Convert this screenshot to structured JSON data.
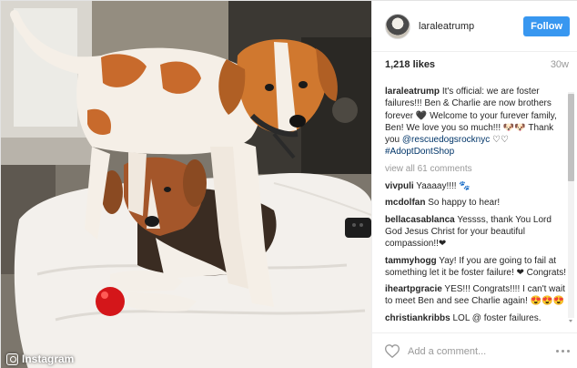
{
  "post": {
    "photo": {
      "alt_description": "",
      "watermark": "Instagram"
    },
    "header": {
      "username": "laraleatrump",
      "follow_label": "Follow"
    },
    "likes": "1,218 likes",
    "time": "30w",
    "caption": {
      "author": "laraleatrump",
      "text_before_mention": "It's official: we are foster failures!!! Ben & Charlie are now brothers forever 🖤 Welcome to your furever family, Ben! We love you so much!!! 🐶🐶 Thank you ",
      "mention": "@rescuedogsrocknyc",
      "text_after_mention": " ♡♡",
      "hashtag": "#AdoptDontShop"
    },
    "view_all_label": "view all 61 comments",
    "comments": [
      {
        "author": "vivpuli",
        "text": "Yaaaay!!!! 🐾"
      },
      {
        "author": "mcdolfan",
        "text": "So happy to hear!"
      },
      {
        "author": "bellacasablanca",
        "text": "Yessss, thank You Lord God Jesus Christ for your beautiful compassion!!❤"
      },
      {
        "author": "tammyhogg",
        "text": "Yay! If you are going to fail at something let it be foster failure! ❤ Congrats!"
      },
      {
        "author": "iheartpgracie",
        "text": "YES!!! Congrats!!!! I can't wait to meet Ben and see Charlie again! 😍😍😍"
      },
      {
        "author": "christiankribbs",
        "text": "LOL @ foster failures."
      }
    ],
    "footer": {
      "comment_placeholder": "Add a comment..."
    }
  },
  "icons": {
    "like": "heart-icon",
    "more": "more-options-icon",
    "watermark": "instagram-camera-icon"
  },
  "colors": {
    "follow_button": "#3897f0",
    "link": "#003569",
    "muted": "#999999"
  }
}
